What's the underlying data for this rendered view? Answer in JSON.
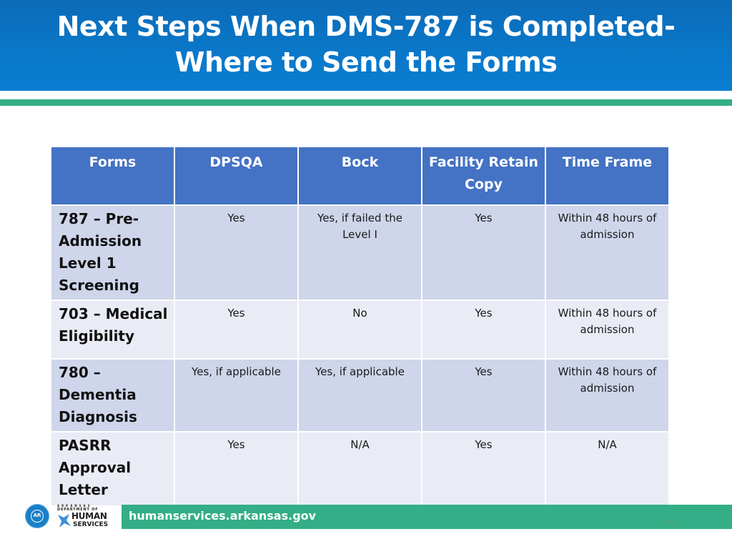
{
  "slide": {
    "title_line1": "Next Steps When DMS-787 is Completed-",
    "title_line2": "Where to Send the Forms",
    "page_number": "24"
  },
  "table": {
    "headers": [
      "Forms",
      "DPSQA",
      "Bock",
      "Facility Retain Copy",
      "Time Frame"
    ],
    "rows": [
      {
        "form": "787 – Pre-Admission Level 1 Screening",
        "dpsqa": "Yes",
        "bock": "Yes, if failed the Level I",
        "facility_retain_copy": "Yes",
        "time_frame": "Within 48 hours of admission"
      },
      {
        "form": "703 – Medical Eligibility",
        "dpsqa": "Yes",
        "bock": "No",
        "facility_retain_copy": "Yes",
        "time_frame": "Within 48 hours of admission"
      },
      {
        "form": "780 – Dementia Diagnosis",
        "dpsqa": "Yes, if applicable",
        "bock": "Yes, if applicable",
        "facility_retain_copy": "Yes",
        "time_frame": "Within 48 hours of admission"
      },
      {
        "form": "PASRR Approval Letter",
        "dpsqa": "Yes",
        "bock": "N/A",
        "facility_retain_copy": "Yes",
        "time_frame": "N/A"
      }
    ]
  },
  "footer": {
    "url": "humanservices.arkansas.gov",
    "seal_icon": "arkansas-state-seal-icon",
    "seal_text": "AR",
    "logo": {
      "top_text": "ARKANSAS",
      "dept_text": "DEPARTMENT OF",
      "human_text": "HUMAN",
      "services_text": "SERVICES",
      "icon": "dhs-star-logo-icon"
    }
  },
  "colors": {
    "header_blue": "#0a77c8",
    "accent_green": "#33ae86",
    "table_header": "#4472c4",
    "row_dark": "#cfd5ea",
    "row_light": "#e9ebf5"
  }
}
